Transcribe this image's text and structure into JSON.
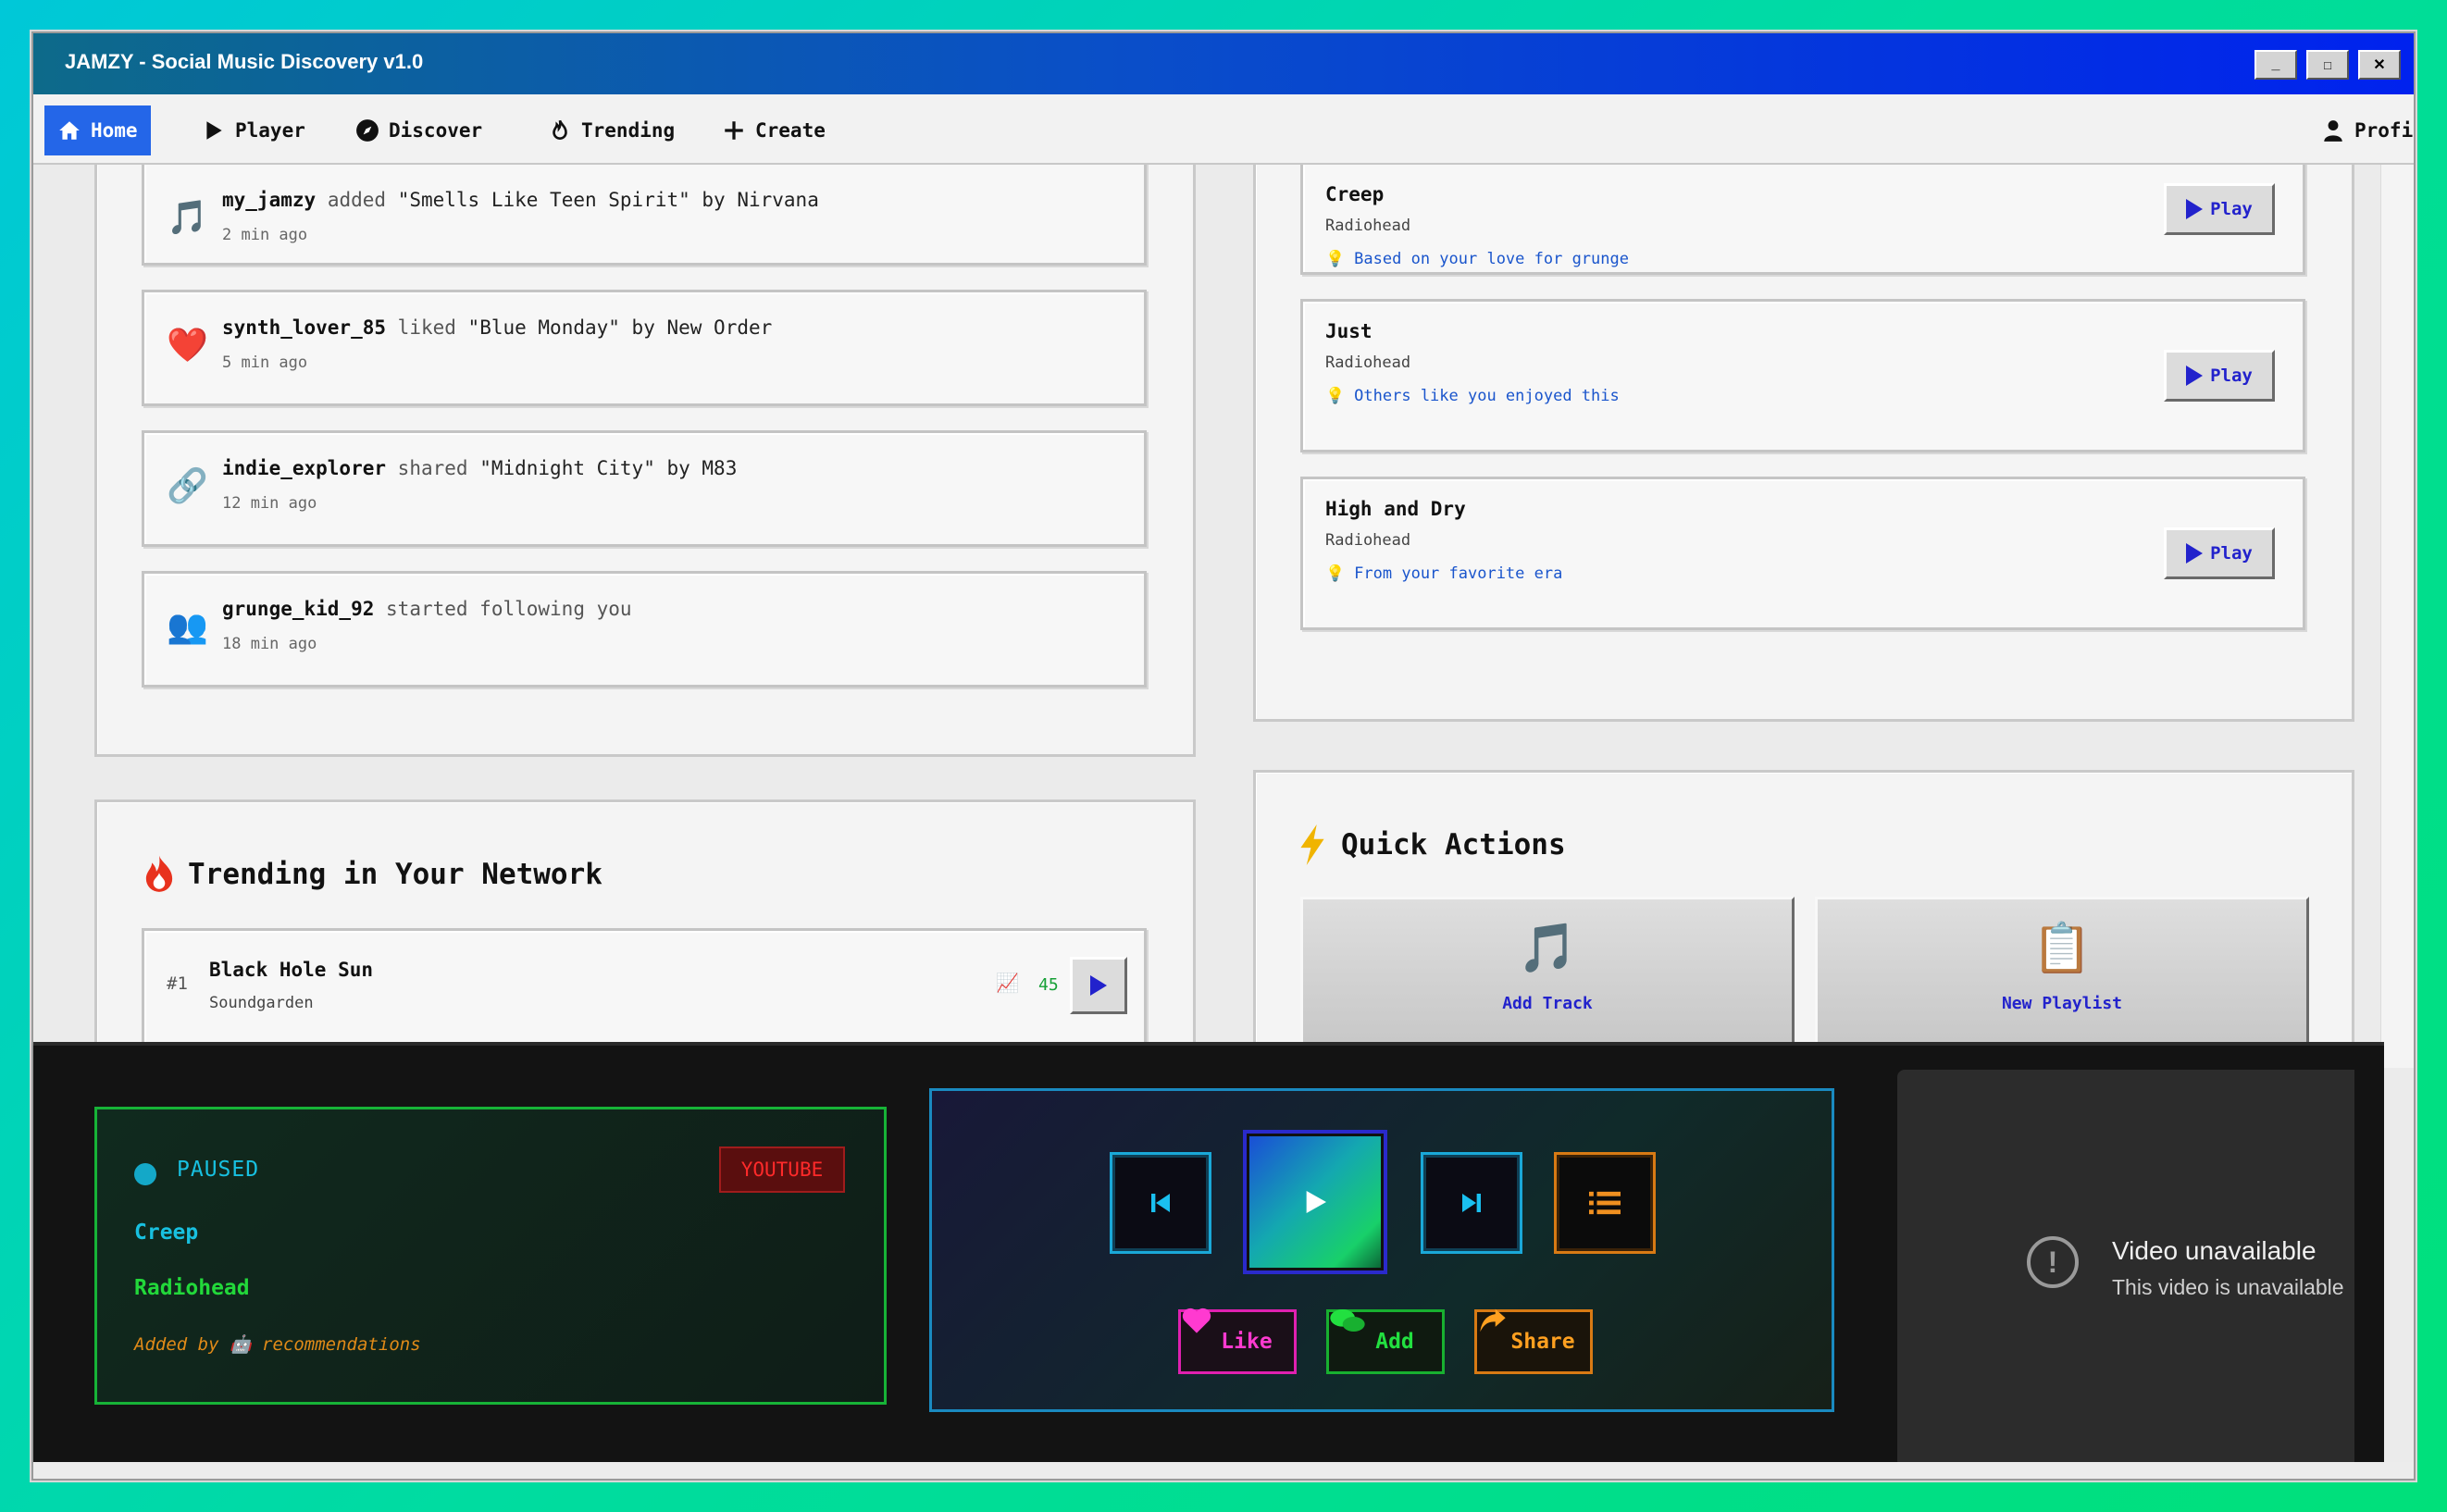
{
  "window": {
    "title": "JAMZY - Social Music Discovery v1.0",
    "minimize": "_",
    "maximize": "□",
    "close": "✕"
  },
  "nav": {
    "items": [
      {
        "label": "Home",
        "icon": "home-icon",
        "active": true
      },
      {
        "label": "Player",
        "icon": "play-icon"
      },
      {
        "label": "Discover",
        "icon": "compass-icon"
      },
      {
        "label": "Trending",
        "icon": "flame-icon"
      },
      {
        "label": "Create",
        "icon": "plus-icon"
      }
    ],
    "profile": {
      "label": "Profile",
      "icon": "user-icon"
    }
  },
  "activity": [
    {
      "icon": "🎵",
      "icon_name": "music-note-icon",
      "user": "my_jamzy",
      "verb": "added",
      "object": "\"Smells Like Teen Spirit\" by Nirvana",
      "time": "2 min ago"
    },
    {
      "icon": "❤️",
      "icon_name": "heart-icon",
      "user": "synth_lover_85",
      "verb": "liked",
      "object": "\"Blue Monday\" by New Order",
      "time": "5 min ago"
    },
    {
      "icon": "🔗",
      "icon_name": "link-icon",
      "user": "indie_explorer",
      "verb": "shared",
      "object": "\"Midnight City\" by M83",
      "time": "12 min ago"
    },
    {
      "icon": "👥",
      "icon_name": "users-icon",
      "user": "grunge_kid_92",
      "verb": "started following you",
      "object": "",
      "time": "18 min ago"
    }
  ],
  "recommendations": [
    {
      "title": "Creep",
      "artist": "Radiohead",
      "reason": "Based on your love for grunge",
      "play_label": "Play"
    },
    {
      "title": "Just",
      "artist": "Radiohead",
      "reason": "Others like you enjoyed this",
      "play_label": "Play"
    },
    {
      "title": "High and Dry",
      "artist": "Radiohead",
      "reason": "From your favorite era",
      "play_label": "Play"
    }
  ],
  "trending": {
    "title": "Trending in Your Network",
    "icon": "flame-icon",
    "items": [
      {
        "rank": "#1",
        "title": "Black Hole Sun",
        "artist": "Soundgarden",
        "trend_icon": "📈",
        "count": "45"
      }
    ]
  },
  "quick_actions": {
    "title": "Quick Actions",
    "icon": "lightning-icon",
    "buttons": [
      {
        "icon": "🎵",
        "icon_name": "music-note-icon",
        "label": "Add Track"
      },
      {
        "icon": "📋",
        "icon_name": "clipboard-icon",
        "label": "New Playlist"
      }
    ]
  },
  "player": {
    "status": "PAUSED",
    "source": "YOUTUBE",
    "title": "Creep",
    "artist": "Radiohead",
    "added_by": "Added by 🤖 recommendations",
    "actions": {
      "like": "Like",
      "add": "Add",
      "share": "Share"
    }
  },
  "video": {
    "title": "Video unavailable",
    "subtitle": "This video is unavailable"
  },
  "colors": {
    "accent": "#2466e8",
    "title_start": "#0d6a8a",
    "title_end": "#0022ee",
    "status_cyan": "#18c0e0",
    "green": "#22d83a",
    "orange": "#e08a18",
    "link_blue": "#1a55cc"
  }
}
